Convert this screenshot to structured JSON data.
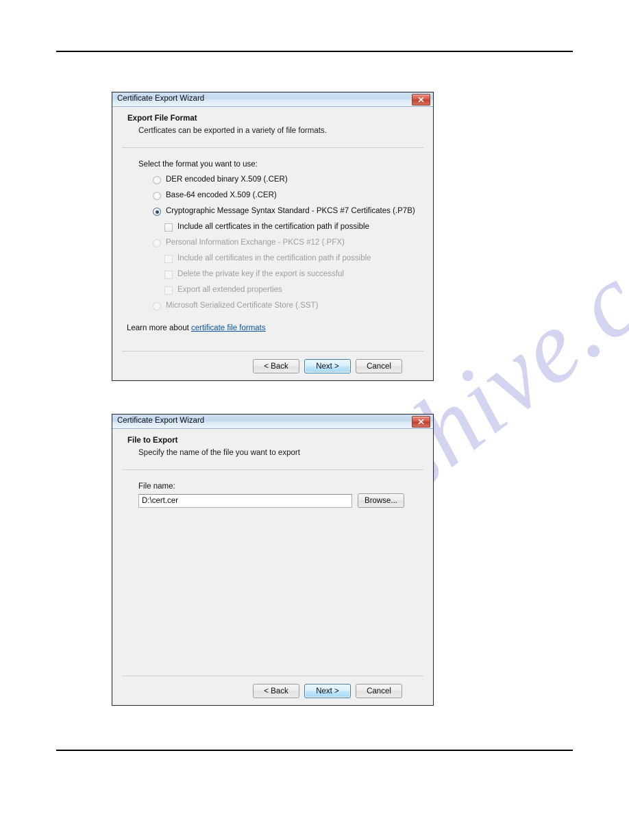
{
  "watermark": {
    "text": "manualshive.com"
  },
  "dialog_format": {
    "title": "Certificate Export Wizard",
    "close_icon": "close-icon",
    "header": {
      "title": "Export File Format",
      "subtitle": "Certficates can be exported in a variety of file formats."
    },
    "prompt": "Select the format you want to use:",
    "options": [
      {
        "label": "DER encoded binary X.509 (.CER)",
        "type": "radio",
        "selected": false,
        "disabled": false,
        "indent": false
      },
      {
        "label": "Base-64 encoded X.509 (.CER)",
        "type": "radio",
        "selected": false,
        "disabled": false,
        "indent": false
      },
      {
        "label": "Cryptographic Message Syntax Standard - PKCS #7 Certificates (.P7B)",
        "type": "radio",
        "selected": true,
        "disabled": false,
        "indent": false
      },
      {
        "label": "Include all certficates in the certification path if possible",
        "type": "checkbox",
        "selected": false,
        "disabled": false,
        "indent": true
      },
      {
        "label": "Personal Information Exchange - PKCS #12 (.PFX)",
        "type": "radio",
        "selected": false,
        "disabled": true,
        "indent": false
      },
      {
        "label": "Include all certificates in the certification path if possible",
        "type": "checkbox",
        "selected": false,
        "disabled": true,
        "indent": true
      },
      {
        "label": "Delete the private key if the export is successful",
        "type": "checkbox",
        "selected": false,
        "disabled": true,
        "indent": true
      },
      {
        "label": "Export all extended properties",
        "type": "checkbox",
        "selected": false,
        "disabled": true,
        "indent": true
      },
      {
        "label": "Microsoft Serialized Certificate Store (.SST)",
        "type": "radio",
        "selected": false,
        "disabled": true,
        "indent": false
      }
    ],
    "learn_more_prefix": "Learn more about ",
    "learn_more_link": "certificate file formats",
    "buttons": {
      "back": "< Back",
      "next": "Next >",
      "cancel": "Cancel"
    }
  },
  "dialog_file": {
    "title": "Certificate Export Wizard",
    "close_icon": "close-icon",
    "header": {
      "title": "File to Export",
      "subtitle": "Specify the name of the file you want to export"
    },
    "file_name_label": "File name:",
    "file_name_value": "D:\\cert.cer",
    "file_name_placeholder": "",
    "browse_label": "Browse...",
    "buttons": {
      "back": "< Back",
      "next": "Next >",
      "cancel": "Cancel"
    }
  },
  "colors": {
    "accent": "#3c7fb1",
    "link": "#0a53a8",
    "close_red": "#c0422f",
    "dialog_bg": "#f0f0f0",
    "watermark": "#b9bce8"
  }
}
